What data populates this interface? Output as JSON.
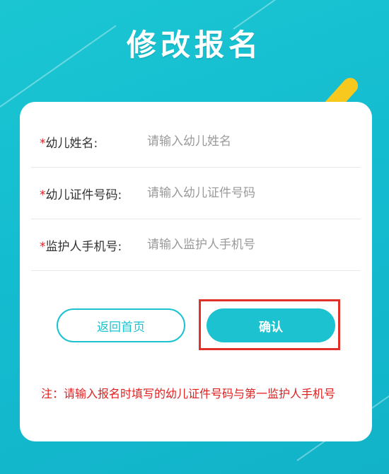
{
  "page": {
    "title": "修改报名"
  },
  "form": {
    "fields": [
      {
        "required_mark": "*",
        "label": "幼儿姓名:",
        "placeholder": "请输入幼儿姓名"
      },
      {
        "required_mark": "*",
        "label": "幼儿证件号码:",
        "placeholder": "请输入幼儿证件号码"
      },
      {
        "required_mark": "*",
        "label": "监护人手机号:",
        "placeholder": "请输入监护人手机号"
      }
    ]
  },
  "buttons": {
    "back_label": "返回首页",
    "confirm_label": "确认"
  },
  "note": "注：请输入报名时填写的幼儿证件号码与第一监护人手机号",
  "colors": {
    "accent": "#1cc2cf",
    "required": "#e02020",
    "highlight_box": "#e0302a",
    "decor_yellow": "#f7c81e"
  }
}
